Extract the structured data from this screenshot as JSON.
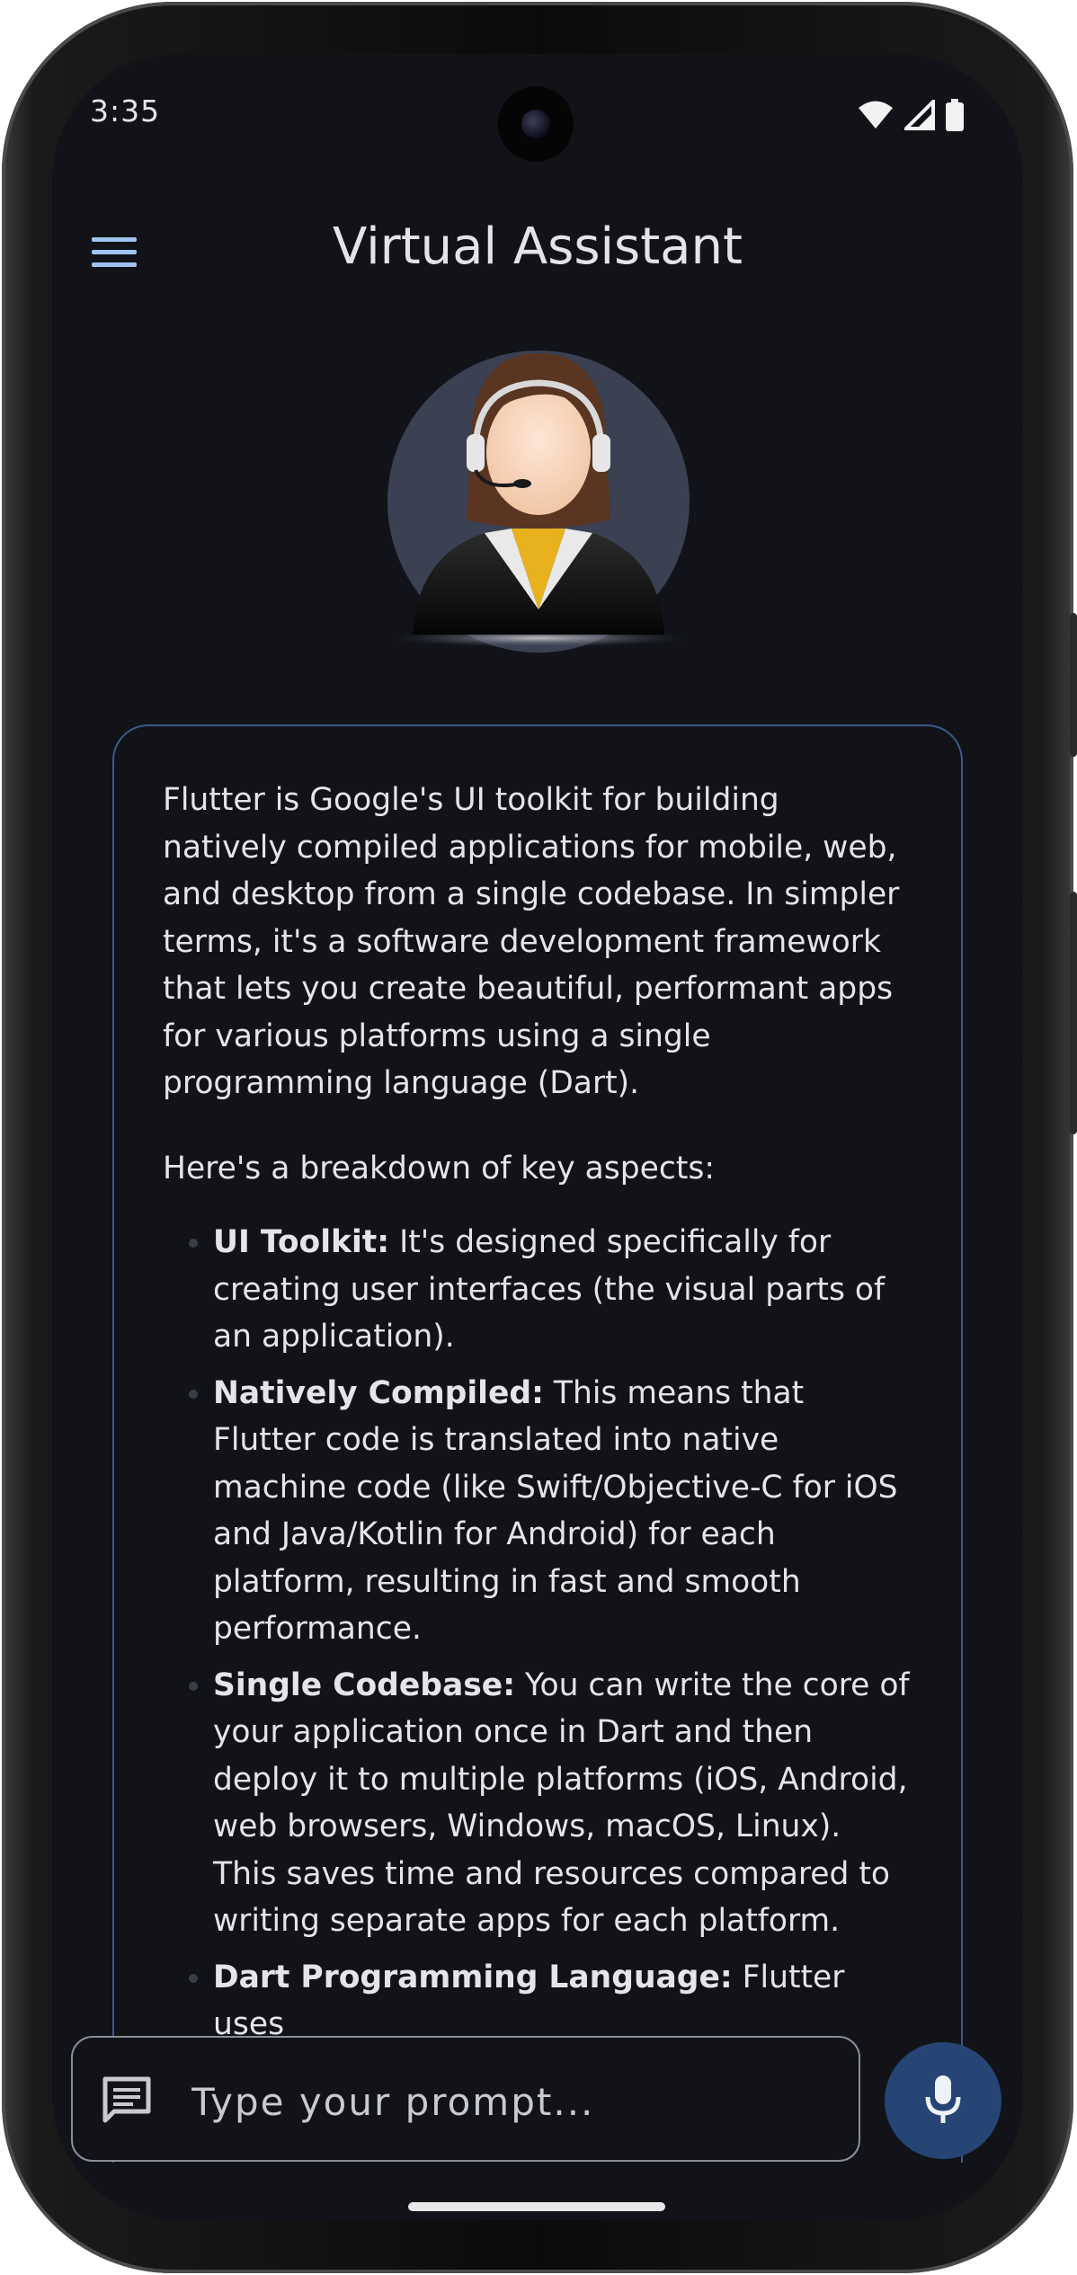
{
  "status_bar": {
    "time": "3:35",
    "icons": [
      "wifi-icon",
      "cellular-signal-icon",
      "battery-icon"
    ]
  },
  "app_bar": {
    "title": "Virtual Assistant",
    "menu_icon": "hamburger-menu-icon"
  },
  "avatar": {
    "icon": "customer-support-agent-avatar"
  },
  "response": {
    "intro": "Flutter is Google's UI toolkit for building natively compiled applications for mobile, web, and desktop from a single codebase.  In simpler terms, it's a software development framework that lets you create beautiful, performant apps for various platforms using a single programming language (Dart).",
    "breakdown_heading": "Here's a breakdown of key aspects:",
    "items": [
      {
        "term": "UI Toolkit:",
        "text": " It's designed specifically for creating user interfaces (the visual parts of an application)."
      },
      {
        "term": "Natively Compiled:",
        "text": "  This means that Flutter code is translated into native machine code (like Swift/Objective-C for iOS and Java/Kotlin for Android) for each platform, resulting in fast and smooth performance."
      },
      {
        "term": "Single Codebase:",
        "text": "  You can write the core of your application once in Dart and then deploy it to multiple platforms (iOS, Android, web browsers, Windows, macOS, Linux). This saves time and resources compared to writing separate apps for each platform."
      },
      {
        "term": "Dart Programming Language:",
        "text": " Flutter uses"
      }
    ]
  },
  "input": {
    "placeholder": "Type your prompt...",
    "value": "",
    "icon": "chat-message-icon"
  },
  "mic_button": {
    "icon": "microphone-icon"
  },
  "colors": {
    "background": "#111318",
    "accent": "#9fc3ee",
    "card_border": "#3c5a8a",
    "mic_button": "#274574",
    "text": "#e4e4ea"
  }
}
